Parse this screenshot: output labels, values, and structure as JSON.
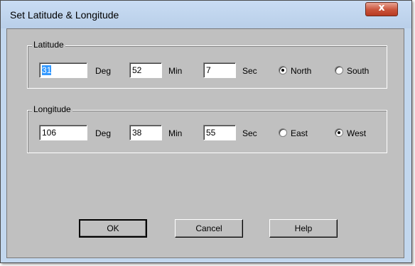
{
  "window": {
    "title": "Set Latitude & Longitude",
    "close_label": "x"
  },
  "latitude": {
    "legend": "Latitude",
    "deg_value": "31",
    "deg_label": "Deg",
    "min_value": "52",
    "min_label": "Min",
    "sec_value": "7",
    "sec_label": "Sec",
    "options": [
      {
        "label": "North",
        "checked": true
      },
      {
        "label": "South",
        "checked": false
      }
    ]
  },
  "longitude": {
    "legend": "Longitude",
    "deg_value": "106",
    "deg_label": "Deg",
    "min_value": "38",
    "min_label": "Min",
    "sec_value": "55",
    "sec_label": "Sec",
    "options": [
      {
        "label": "East",
        "checked": false
      },
      {
        "label": "West",
        "checked": true
      }
    ]
  },
  "buttons": {
    "ok": "OK",
    "cancel": "Cancel",
    "help": "Help"
  }
}
